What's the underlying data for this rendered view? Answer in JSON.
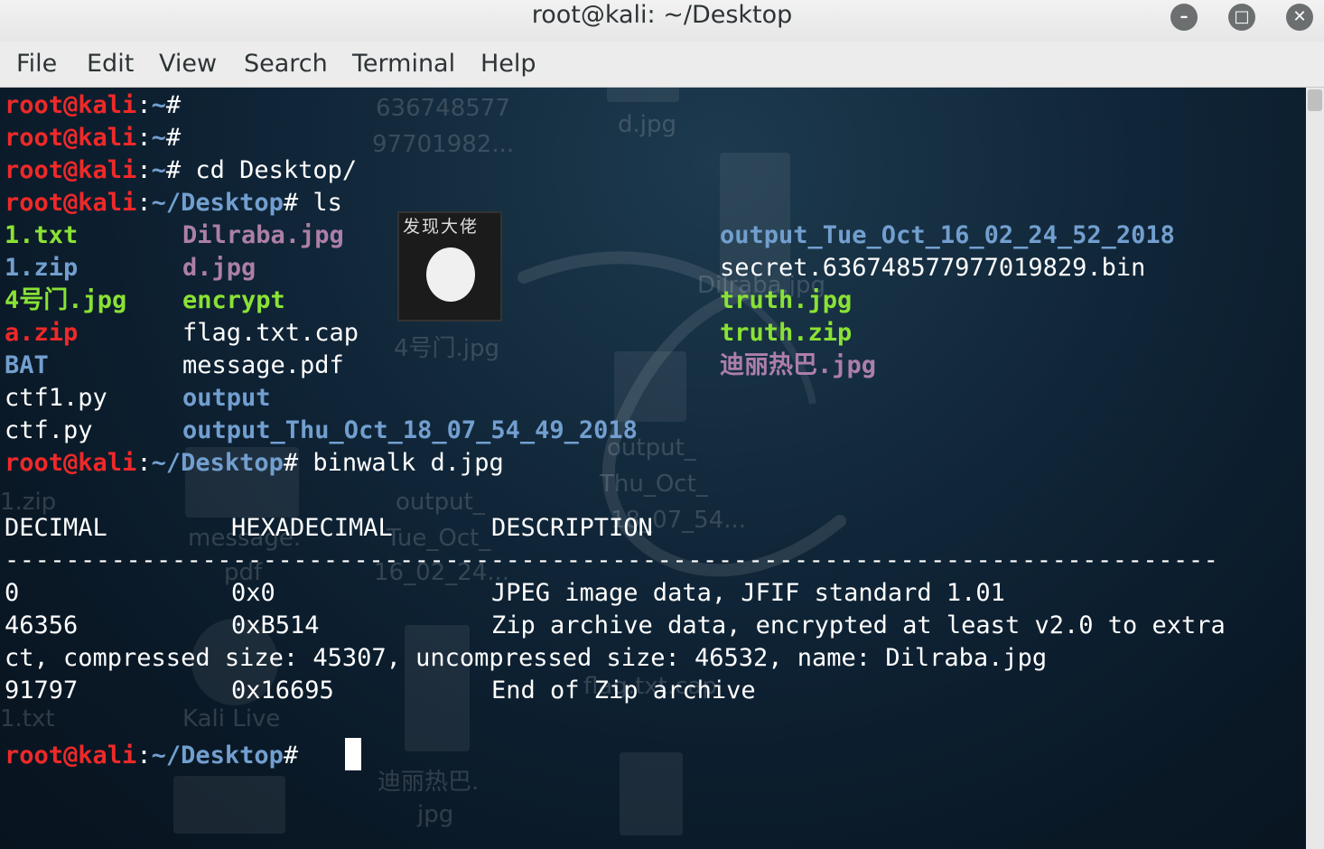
{
  "window": {
    "title": "root@kali: ~/Desktop",
    "buttons": [
      "minimize-icon",
      "maximize-icon",
      "close-icon"
    ]
  },
  "menu": [
    "File",
    "Edit",
    "View",
    "Search",
    "Terminal",
    "Help"
  ],
  "prompt": {
    "user_host": "root@kali",
    "home": "~",
    "desktop": "~/Desktop",
    "symbol": "#"
  },
  "commands": {
    "cd": " cd Desktop/",
    "ls": " ls",
    "binwalk": " binwalk d.jpg"
  },
  "ls_output": {
    "col1": [
      {
        "name": "1.txt",
        "color": "green"
      },
      {
        "name": "1.zip",
        "color": "blue"
      },
      {
        "name": "4号门.jpg",
        "color": "green"
      },
      {
        "name": "a.zip",
        "color": "red"
      },
      {
        "name": "BAT",
        "color": "blue"
      },
      {
        "name": "ctf1.py",
        "color": "white"
      },
      {
        "name": "ctf.py",
        "color": "white"
      }
    ],
    "col2": [
      {
        "name": "Dilraba.jpg",
        "color": "magenta"
      },
      {
        "name": "d.jpg",
        "color": "magenta"
      },
      {
        "name": "encrypt",
        "color": "green"
      },
      {
        "name": "flag.txt.cap",
        "color": "white"
      },
      {
        "name": "message.pdf",
        "color": "white"
      },
      {
        "name": "output",
        "color": "blue"
      },
      {
        "name": "output_Thu_Oct_18_07_54_49_2018",
        "color": "blue"
      }
    ],
    "col3": [
      {
        "name": "output_Tue_Oct_16_02_24_52_2018",
        "color": "blue"
      },
      {
        "name": "secret.636748577977019829.bin",
        "color": "white"
      },
      {
        "name": "truth.jpg",
        "color": "green"
      },
      {
        "name": "truth.zip",
        "color": "green"
      },
      {
        "name": "迪丽热巴.jpg",
        "color": "magenta"
      }
    ]
  },
  "binwalk": {
    "headers": [
      "DECIMAL",
      "HEXADECIMAL",
      "DESCRIPTION"
    ],
    "separator": "--------------------------------------------------------------------------------",
    "rows": [
      {
        "decimal": "0",
        "hex": "0x0",
        "desc": "JPEG image data, JFIF standard 1.01"
      },
      {
        "decimal": "46356",
        "hex": "0xB514",
        "desc": "Zip archive data, encrypted at least v2.0 to extra"
      },
      {
        "decimal": "91797",
        "hex": "0x16695",
        "desc": "End of Zip archive"
      }
    ],
    "wrap_line": "ct, compressed size: 45307, uncompressed size: 46532, name: Dilraba.jpg"
  },
  "desktop_labels": [
    "636748577",
    "97701982...",
    "d.jpg",
    "Dilraba.jpg",
    "4号门.jpg",
    "output_",
    "Thu_Oct_",
    "18_07_54...",
    "1.zip",
    "output_",
    "Tue_Oct_",
    "16_02_24...",
    "message.",
    "pdf",
    "flag.txt.cap",
    "1.txt",
    "Kali Live",
    "迪丽热巴.",
    "jpg",
    "发现大佬"
  ],
  "colors": {
    "prompt_red": "#ef2929",
    "path_blue": "#729fcf",
    "exec_green": "#8ae234",
    "image_magenta": "#ad7fa8",
    "terminal_bg": "#0c1c2c"
  }
}
